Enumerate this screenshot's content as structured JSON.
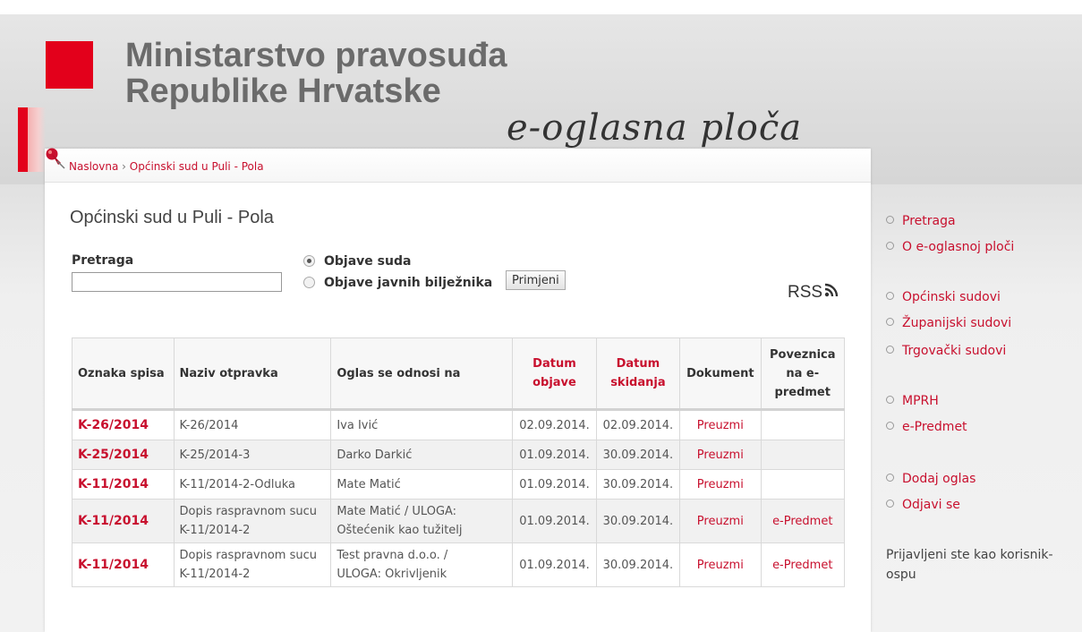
{
  "header": {
    "ministry_line1": "Ministarstvo pravosuđa",
    "ministry_line2": "Republike Hrvatske",
    "eoglasna": "e-oglasna ploča"
  },
  "breadcrumb": {
    "home": "Naslovna",
    "separator": "›",
    "current": "Općinski sud u Puli - Pola"
  },
  "page": {
    "title": "Općinski sud u Puli - Pola"
  },
  "search": {
    "label": "Pretraga",
    "value": "",
    "radio_court": "Objave suda",
    "radio_notary": "Objave javnih bilježnika",
    "apply": "Primjeni",
    "rss": "RSS"
  },
  "table": {
    "headers": [
      "Oznaka spisa",
      "Naziv otpravka",
      "Oglas se odnosi na",
      "Datum objave",
      "Datum skidanja",
      "Dokument",
      "Poveznica na e-predmet"
    ],
    "rows": [
      {
        "code": "K-26/2014",
        "name": "K-26/2014",
        "name2": "",
        "subject": "Iva Ivić",
        "subject2": "",
        "published": "02.09.2014.",
        "removed": "02.09.2014.",
        "document": "Preuzmi",
        "link": ""
      },
      {
        "code": "K-25/2014",
        "name": "K-25/2014-3",
        "name2": "",
        "subject": "Darko Darkić",
        "subject2": "",
        "published": "01.09.2014.",
        "removed": "30.09.2014.",
        "document": "Preuzmi",
        "link": ""
      },
      {
        "code": "K-11/2014",
        "name": "K-11/2014-2-Odluka",
        "name2": "",
        "subject": "Mate Matić",
        "subject2": "",
        "published": "01.09.2014.",
        "removed": "30.09.2014.",
        "document": "Preuzmi",
        "link": ""
      },
      {
        "code": "K-11/2014",
        "name": "Dopis raspravnom sucu",
        "name2": "K-11/2014-2",
        "subject": "Mate Matić / ULOGA:",
        "subject2": "Oštećenik kao tužitelj",
        "published": "01.09.2014.",
        "removed": "30.09.2014.",
        "document": "Preuzmi",
        "link": "e-Predmet"
      },
      {
        "code": "K-11/2014",
        "name": "Dopis raspravnom sucu",
        "name2": "K-11/2014-2",
        "subject": "Test pravna d.o.o. /",
        "subject2": "ULOGA: Okrivljenik",
        "published": "01.09.2014.",
        "removed": "30.09.2014.",
        "document": "Preuzmi",
        "link": "e-Predmet"
      }
    ]
  },
  "sidebar": {
    "items": [
      "Pretraga",
      "O e-oglasnoj ploči",
      "Općinski sudovi",
      "Županijski sudovi",
      "Trgovački sudovi",
      "MPRH",
      "e-Predmet",
      "Dodaj oglas",
      "Odjavi se"
    ],
    "logged_in": "Prijavljeni ste kao korisnik-ospu"
  },
  "colors": {
    "accent": "#c8102e",
    "logo_red": "#e3001b"
  }
}
